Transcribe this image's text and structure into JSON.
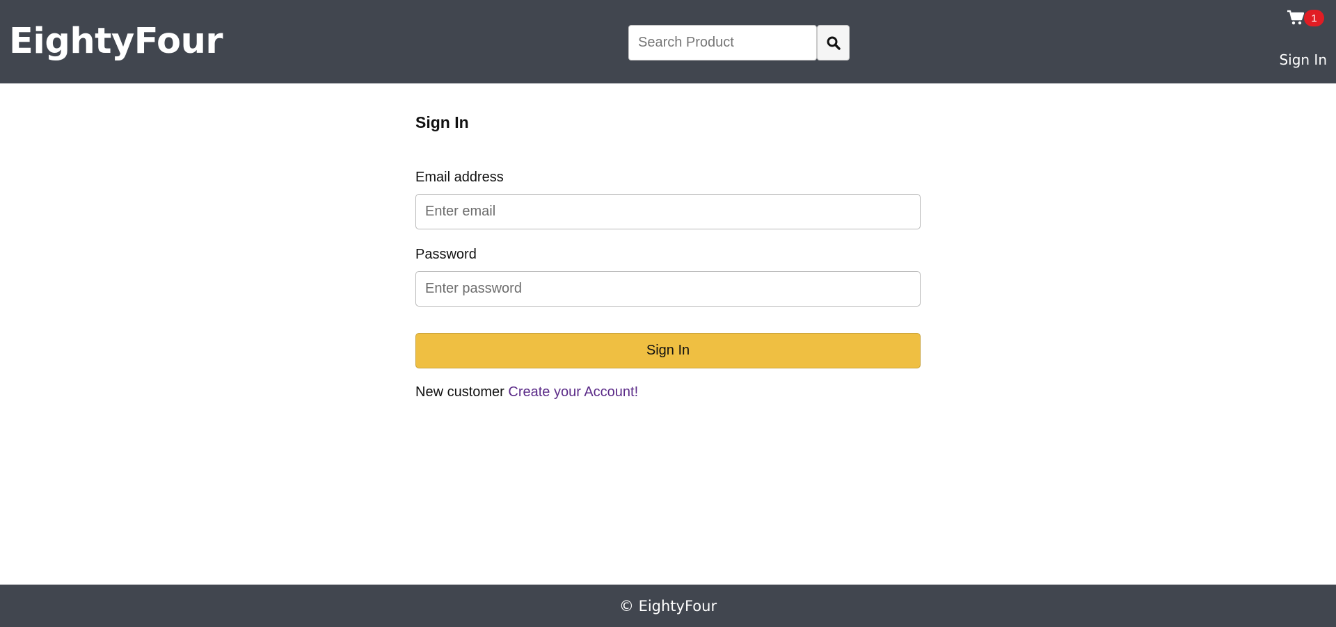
{
  "header": {
    "brand": "EightyFour",
    "search": {
      "placeholder": "Search Product",
      "value": ""
    },
    "search_button_icon": "search-icon",
    "cart": {
      "icon": "cart-icon",
      "count": "1"
    },
    "nav_signin": "Sign In"
  },
  "form": {
    "title": "Sign In",
    "email": {
      "label": "Email address",
      "placeholder": "Enter email",
      "value": ""
    },
    "password": {
      "label": "Password",
      "placeholder": "Enter password",
      "value": ""
    },
    "submit_label": "Sign In",
    "register_prompt": "New customer",
    "register_link": "Create your Account!"
  },
  "footer": {
    "text": "© EightyFour"
  },
  "colors": {
    "header_bg": "#41464f",
    "button_bg": "#efbf42",
    "badge_bg": "#e11d24",
    "link": "#5b2b88"
  }
}
